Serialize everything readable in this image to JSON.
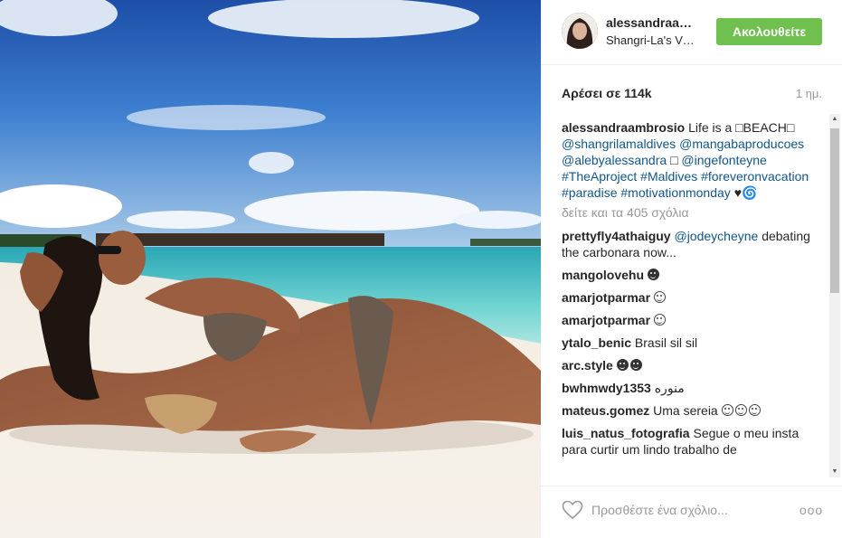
{
  "post": {
    "photo_alt": "Photo by alessandraambrosio"
  },
  "header": {
    "username": "alessandraambrosio",
    "location": "Shangri-La's Villingili Resort and Spa",
    "follow_label": "Ακολουθείτε",
    "follow_color": "#70c050"
  },
  "stats": {
    "likes": "Αρέσει σε 114k",
    "age": "1 ημ."
  },
  "caption": {
    "user": "alessandraambrosio",
    "line_text": "Life is a ",
    "beach": "BEACH",
    "tags": [
      "@shangrilamaldives",
      "@mangabaproducoes",
      "@alebyalessandra",
      "@ingefonteyne",
      "#TheAproject",
      "#Maldives",
      "#foreveronvacation",
      "#paradise",
      "#motivationmonday"
    ]
  },
  "view_all": "δείτε και τα 405 σχόλια",
  "comments": [
    {
      "user": "prettyfly4athaiguy",
      "mention": "@jodeycheyne",
      "text": "debating the carbonara now..."
    },
    {
      "user": "mangolovehu",
      "text": ""
    },
    {
      "user": "amarjotparmar",
      "text": ""
    },
    {
      "user": "amarjotparmar",
      "text": ""
    },
    {
      "user": "ytalo_benic",
      "text": "Brasil sil sil"
    },
    {
      "user": "arc.style",
      "text": ""
    },
    {
      "user": "bwhmwdy1353",
      "text": "منوره"
    },
    {
      "user": "mateus.gomez",
      "text": "Uma sereia"
    },
    {
      "user": "luis_natus_fotografia",
      "text": "Segue o meu insta para curtir um lindo trabalho de"
    }
  ],
  "footer": {
    "comment_placeholder": "Προσθέστε ένα σχόλιο...",
    "more_label": "ooo"
  },
  "icons": {
    "heart": "heart-outline-icon",
    "more": "more-options-icon",
    "heart_emoji": "black-heart",
    "face_emoji": "smiling-face"
  },
  "colors": {
    "link": "#125688",
    "muted": "#999999",
    "text": "#262626"
  }
}
